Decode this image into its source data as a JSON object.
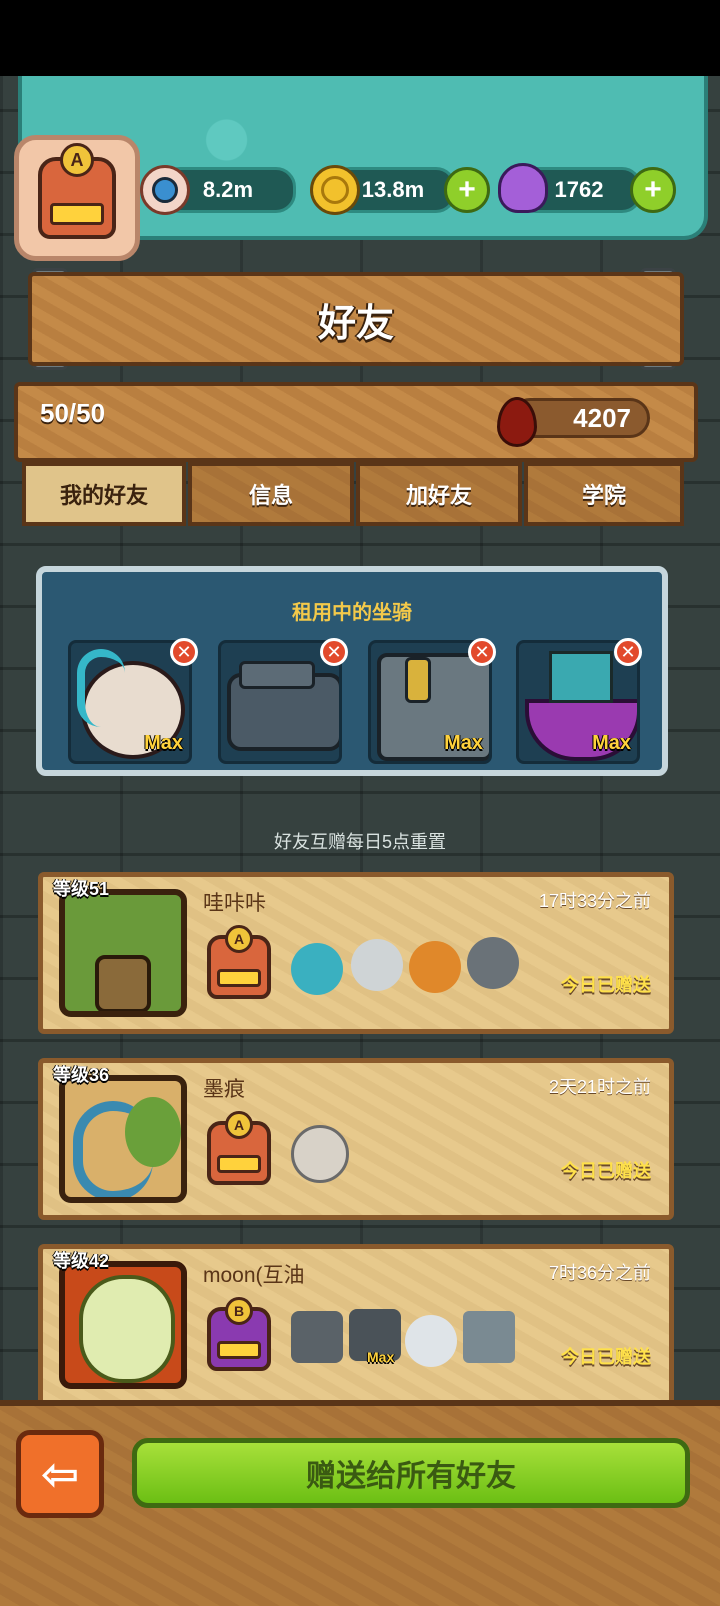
{
  "resources": {
    "eyes": "8.2m",
    "coins": "13.8m",
    "potions": "1762"
  },
  "header": {
    "title": "好友",
    "friend_count": "50/50",
    "blood": "4207"
  },
  "tabs": [
    {
      "label": "我的好友",
      "active": true
    },
    {
      "label": "信息",
      "active": false
    },
    {
      "label": "加好友",
      "active": false
    },
    {
      "label": "学院",
      "active": false
    }
  ],
  "rented_mounts": {
    "title": "租用中的坐骑",
    "slots": [
      {
        "max_label": "Max"
      },
      {
        "max_label": ""
      },
      {
        "max_label": "Max"
      },
      {
        "max_label": "Max"
      }
    ]
  },
  "reset_note": "好友互赠每日5点重置",
  "friends": [
    {
      "level": "等级51",
      "name": "哇咔咔",
      "time": "17时33分之前",
      "gift": "今日已赠送",
      "rank": "A"
    },
    {
      "level": "等级36",
      "name": "墨痕",
      "time": "2天21时之前",
      "gift": "今日已赠送",
      "rank": "A"
    },
    {
      "level": "等级42",
      "name": "moon(互油",
      "time": "7时36分之前",
      "gift": "今日已赠送",
      "rank": "B",
      "mount_max": "Max"
    }
  ],
  "bottom": {
    "gift_all_label": "赠送给所有好友"
  },
  "colors": {
    "accent_green": "#8fcf2a",
    "gift_text": "#ffe14a",
    "panel_blue": "#2b5872"
  }
}
